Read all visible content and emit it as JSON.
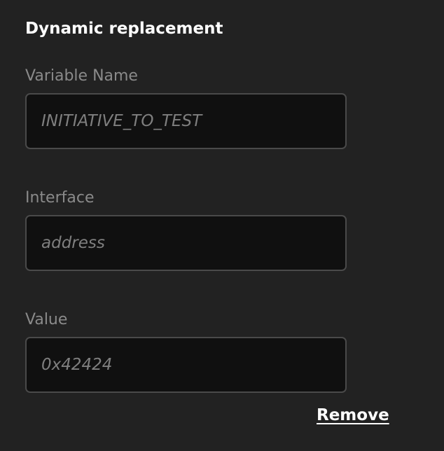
{
  "section": {
    "title": "Dynamic replacement"
  },
  "fields": {
    "variable_name": {
      "label": "Variable Name",
      "value": "",
      "placeholder": "INITIATIVE_TO_TEST"
    },
    "interface": {
      "label": "Interface",
      "value": "",
      "placeholder": "address"
    },
    "value": {
      "label": "Value",
      "value": "",
      "placeholder": "0x42424"
    }
  },
  "actions": {
    "remove_label": "Remove"
  }
}
